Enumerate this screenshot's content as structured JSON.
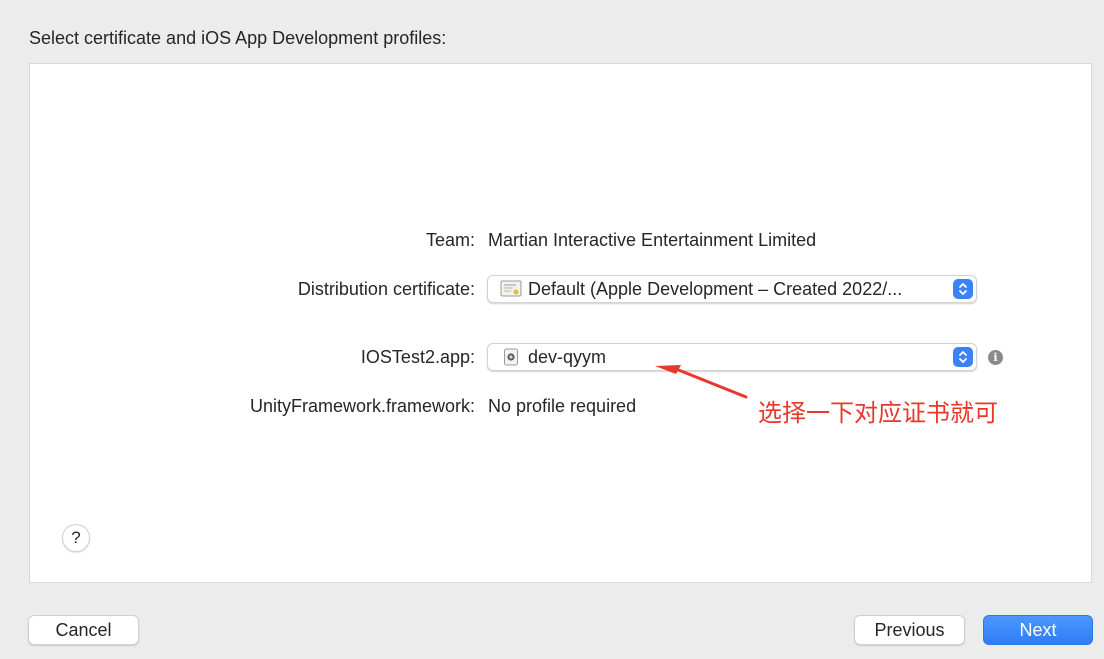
{
  "header": {
    "title": "Select certificate and iOS App Development profiles:"
  },
  "form": {
    "team": {
      "label": "Team:",
      "value": "Martian Interactive Entertainment Limited"
    },
    "distribution_certificate": {
      "label": "Distribution certificate:",
      "selected": "Default (Apple Development – Created 2022/..."
    },
    "app_profile": {
      "label": "IOSTest2.app:",
      "selected": "dev-qyym"
    },
    "framework": {
      "label": "UnityFramework.framework:",
      "value": "No profile required"
    }
  },
  "annotation": {
    "text": "选择一下对应证书就可",
    "color": "#e8372c"
  },
  "footer": {
    "cancel_label": "Cancel",
    "previous_label": "Previous",
    "next_label": "Next"
  },
  "help": {
    "label": "?"
  },
  "colors": {
    "accent": "#3b82f6",
    "annotation": "#e8372c"
  }
}
